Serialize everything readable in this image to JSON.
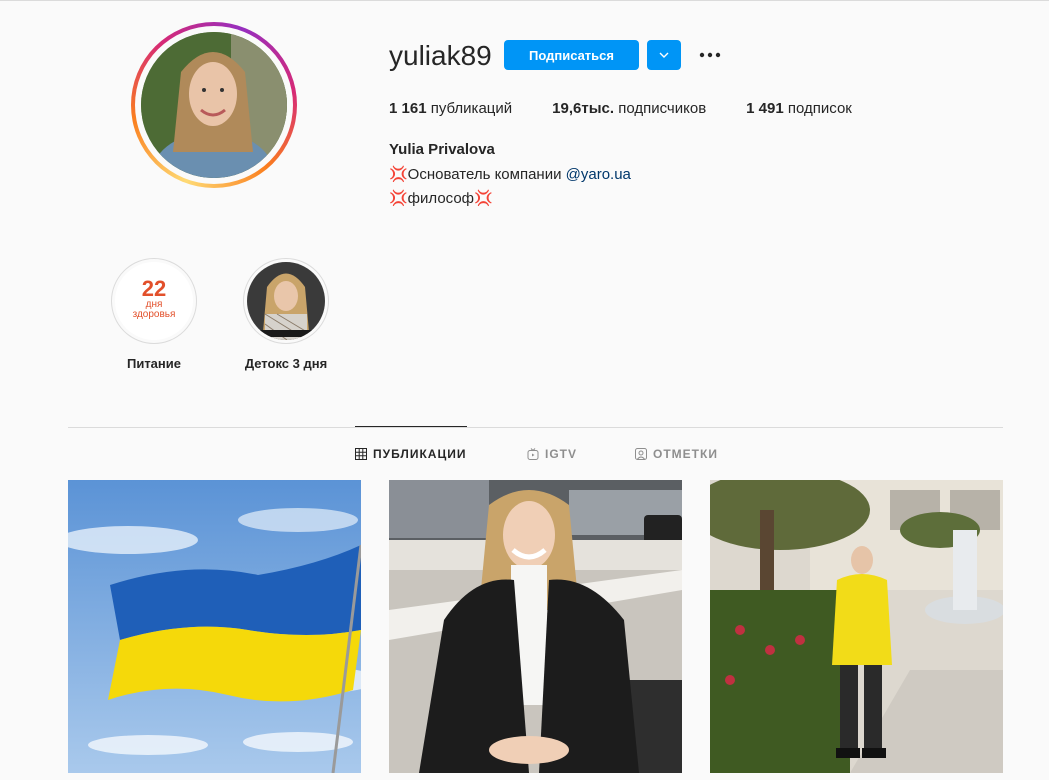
{
  "profile": {
    "username": "yuliak89",
    "follow_label": "Подписаться",
    "stats": {
      "posts_count": "1 161",
      "posts_label": "публикаций",
      "followers_count": "19,6тыс.",
      "followers_label": "подписчиков",
      "following_count": "1 491",
      "following_label": "подписок"
    },
    "full_name": "Yulia Privalova",
    "bio_line1_prefix": "💢Основатель компании ",
    "bio_line1_link": "@yaro.ua",
    "bio_line2": "💢философ💢"
  },
  "highlights": [
    {
      "label": "Питание",
      "cover_big": "22",
      "cover_line1": "дня",
      "cover_line2": "здоровья"
    },
    {
      "label": "Детокс 3 дня"
    }
  ],
  "tabs": [
    {
      "label": "ПУБЛИКАЦИИ",
      "icon": "grid-icon",
      "active": true
    },
    {
      "label": "IGTV",
      "icon": "igtv-icon",
      "active": false
    },
    {
      "label": "ОТМЕТКИ",
      "icon": "tagged-icon",
      "active": false
    }
  ],
  "posts": [
    {
      "subject": "ukraine-flag-photo"
    },
    {
      "subject": "woman-leather-jacket-photo"
    },
    {
      "subject": "woman-yellow-sweater-photo"
    }
  ],
  "colors": {
    "accent": "#0095f6",
    "link": "#00376b",
    "flag_blue": "#1f5fb8",
    "flag_yellow": "#f5d90a",
    "highlight_red": "#e2502b"
  }
}
